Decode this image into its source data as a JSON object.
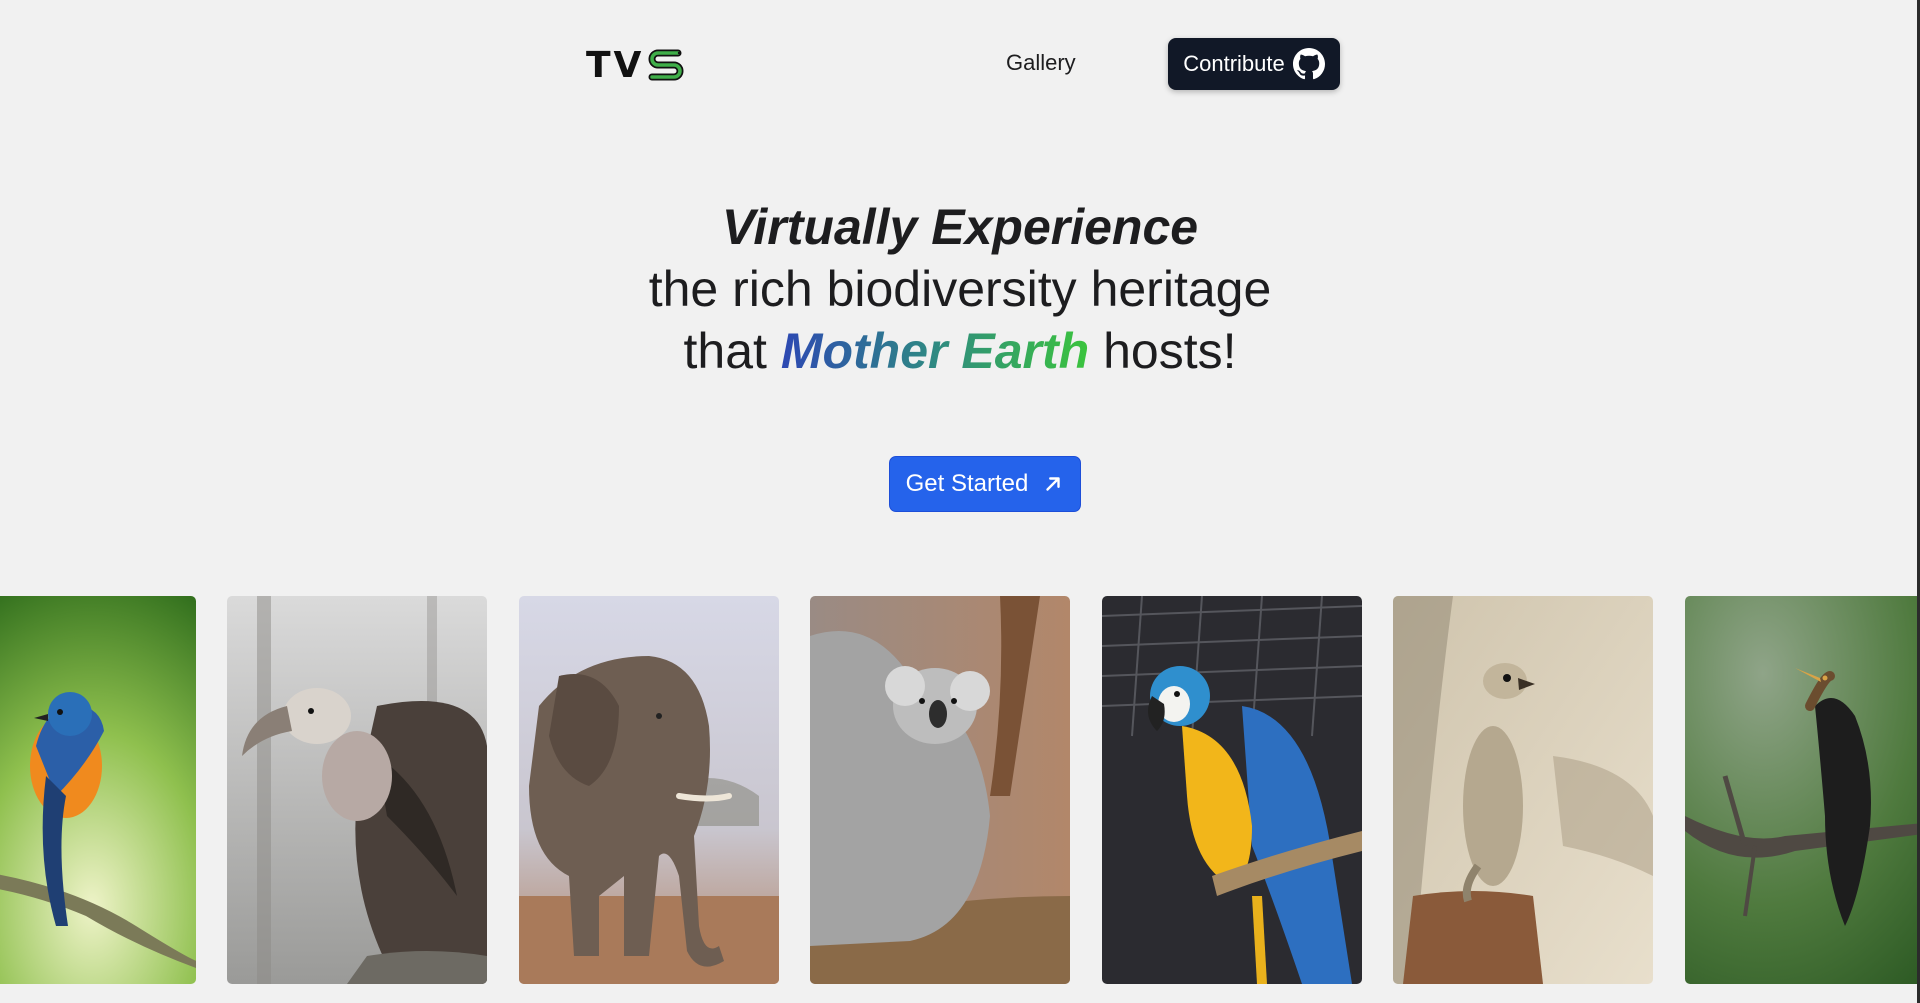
{
  "header": {
    "logo_text": "TV",
    "logo_icon": "snake-s-icon",
    "nav_gallery_label": "Gallery",
    "contribute_label": "Contribute",
    "contribute_icon": "github-icon"
  },
  "hero": {
    "line1": "Virtually Experience",
    "line2": "the rich biodiversity heritage",
    "line3_prefix": "that",
    "line3_highlight": "Mother Earth",
    "line3_suffix": "hosts!",
    "highlight_gradient": [
      "#2d48b3",
      "#3bc43d"
    ],
    "cta_label": "Get Started",
    "cta_icon": "arrow-up-right-icon",
    "cta_color": "#2563eb"
  },
  "gallery": {
    "cards": [
      {
        "subject": "blue-orange-flycatcher-bird"
      },
      {
        "subject": "vulture"
      },
      {
        "subject": "elephant"
      },
      {
        "subject": "koala"
      },
      {
        "subject": "blue-and-yellow-macaw"
      },
      {
        "subject": "meerkat"
      },
      {
        "subject": "darter-bird"
      }
    ]
  }
}
